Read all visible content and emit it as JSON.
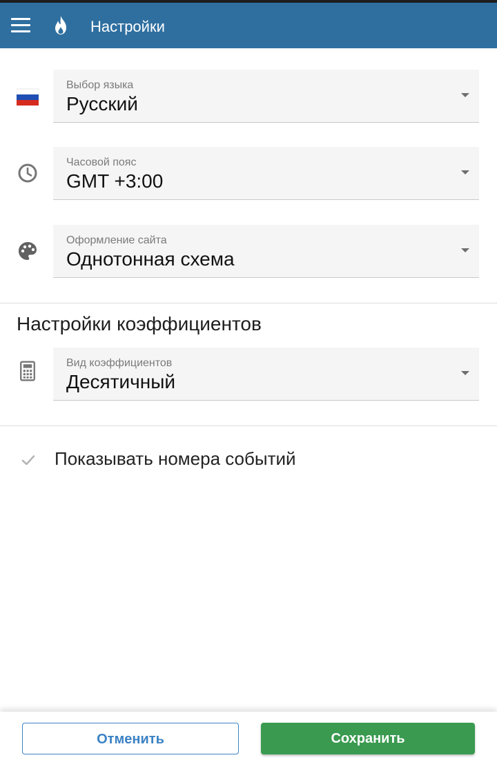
{
  "header": {
    "title": "Настройки",
    "menu_icon": "hamburger-menu-icon",
    "logo_icon": "flame-icon",
    "bg_color": "#2f6fa0"
  },
  "settings": [
    {
      "icon": "russia-flag-icon",
      "label": "Выбор языка",
      "value": "Русский"
    },
    {
      "icon": "clock-icon",
      "label": "Часовой пояс",
      "value": "GMT +3:00"
    },
    {
      "icon": "palette-icon",
      "label": "Оформление сайта",
      "value": "Однотонная схема"
    }
  ],
  "odds_section": {
    "title": "Настройки коэффициентов",
    "field": {
      "icon": "calculator-icon",
      "label": "Вид коэффициентов",
      "value": "Десятичный"
    }
  },
  "options": {
    "show_event_numbers": {
      "label": "Показывать номера событий",
      "icon": "check-icon",
      "checked": true
    }
  },
  "footer": {
    "cancel_label": "Отменить",
    "save_label": "Сохранить",
    "save_color": "#3a9a50",
    "cancel_color": "#3b82c4"
  }
}
